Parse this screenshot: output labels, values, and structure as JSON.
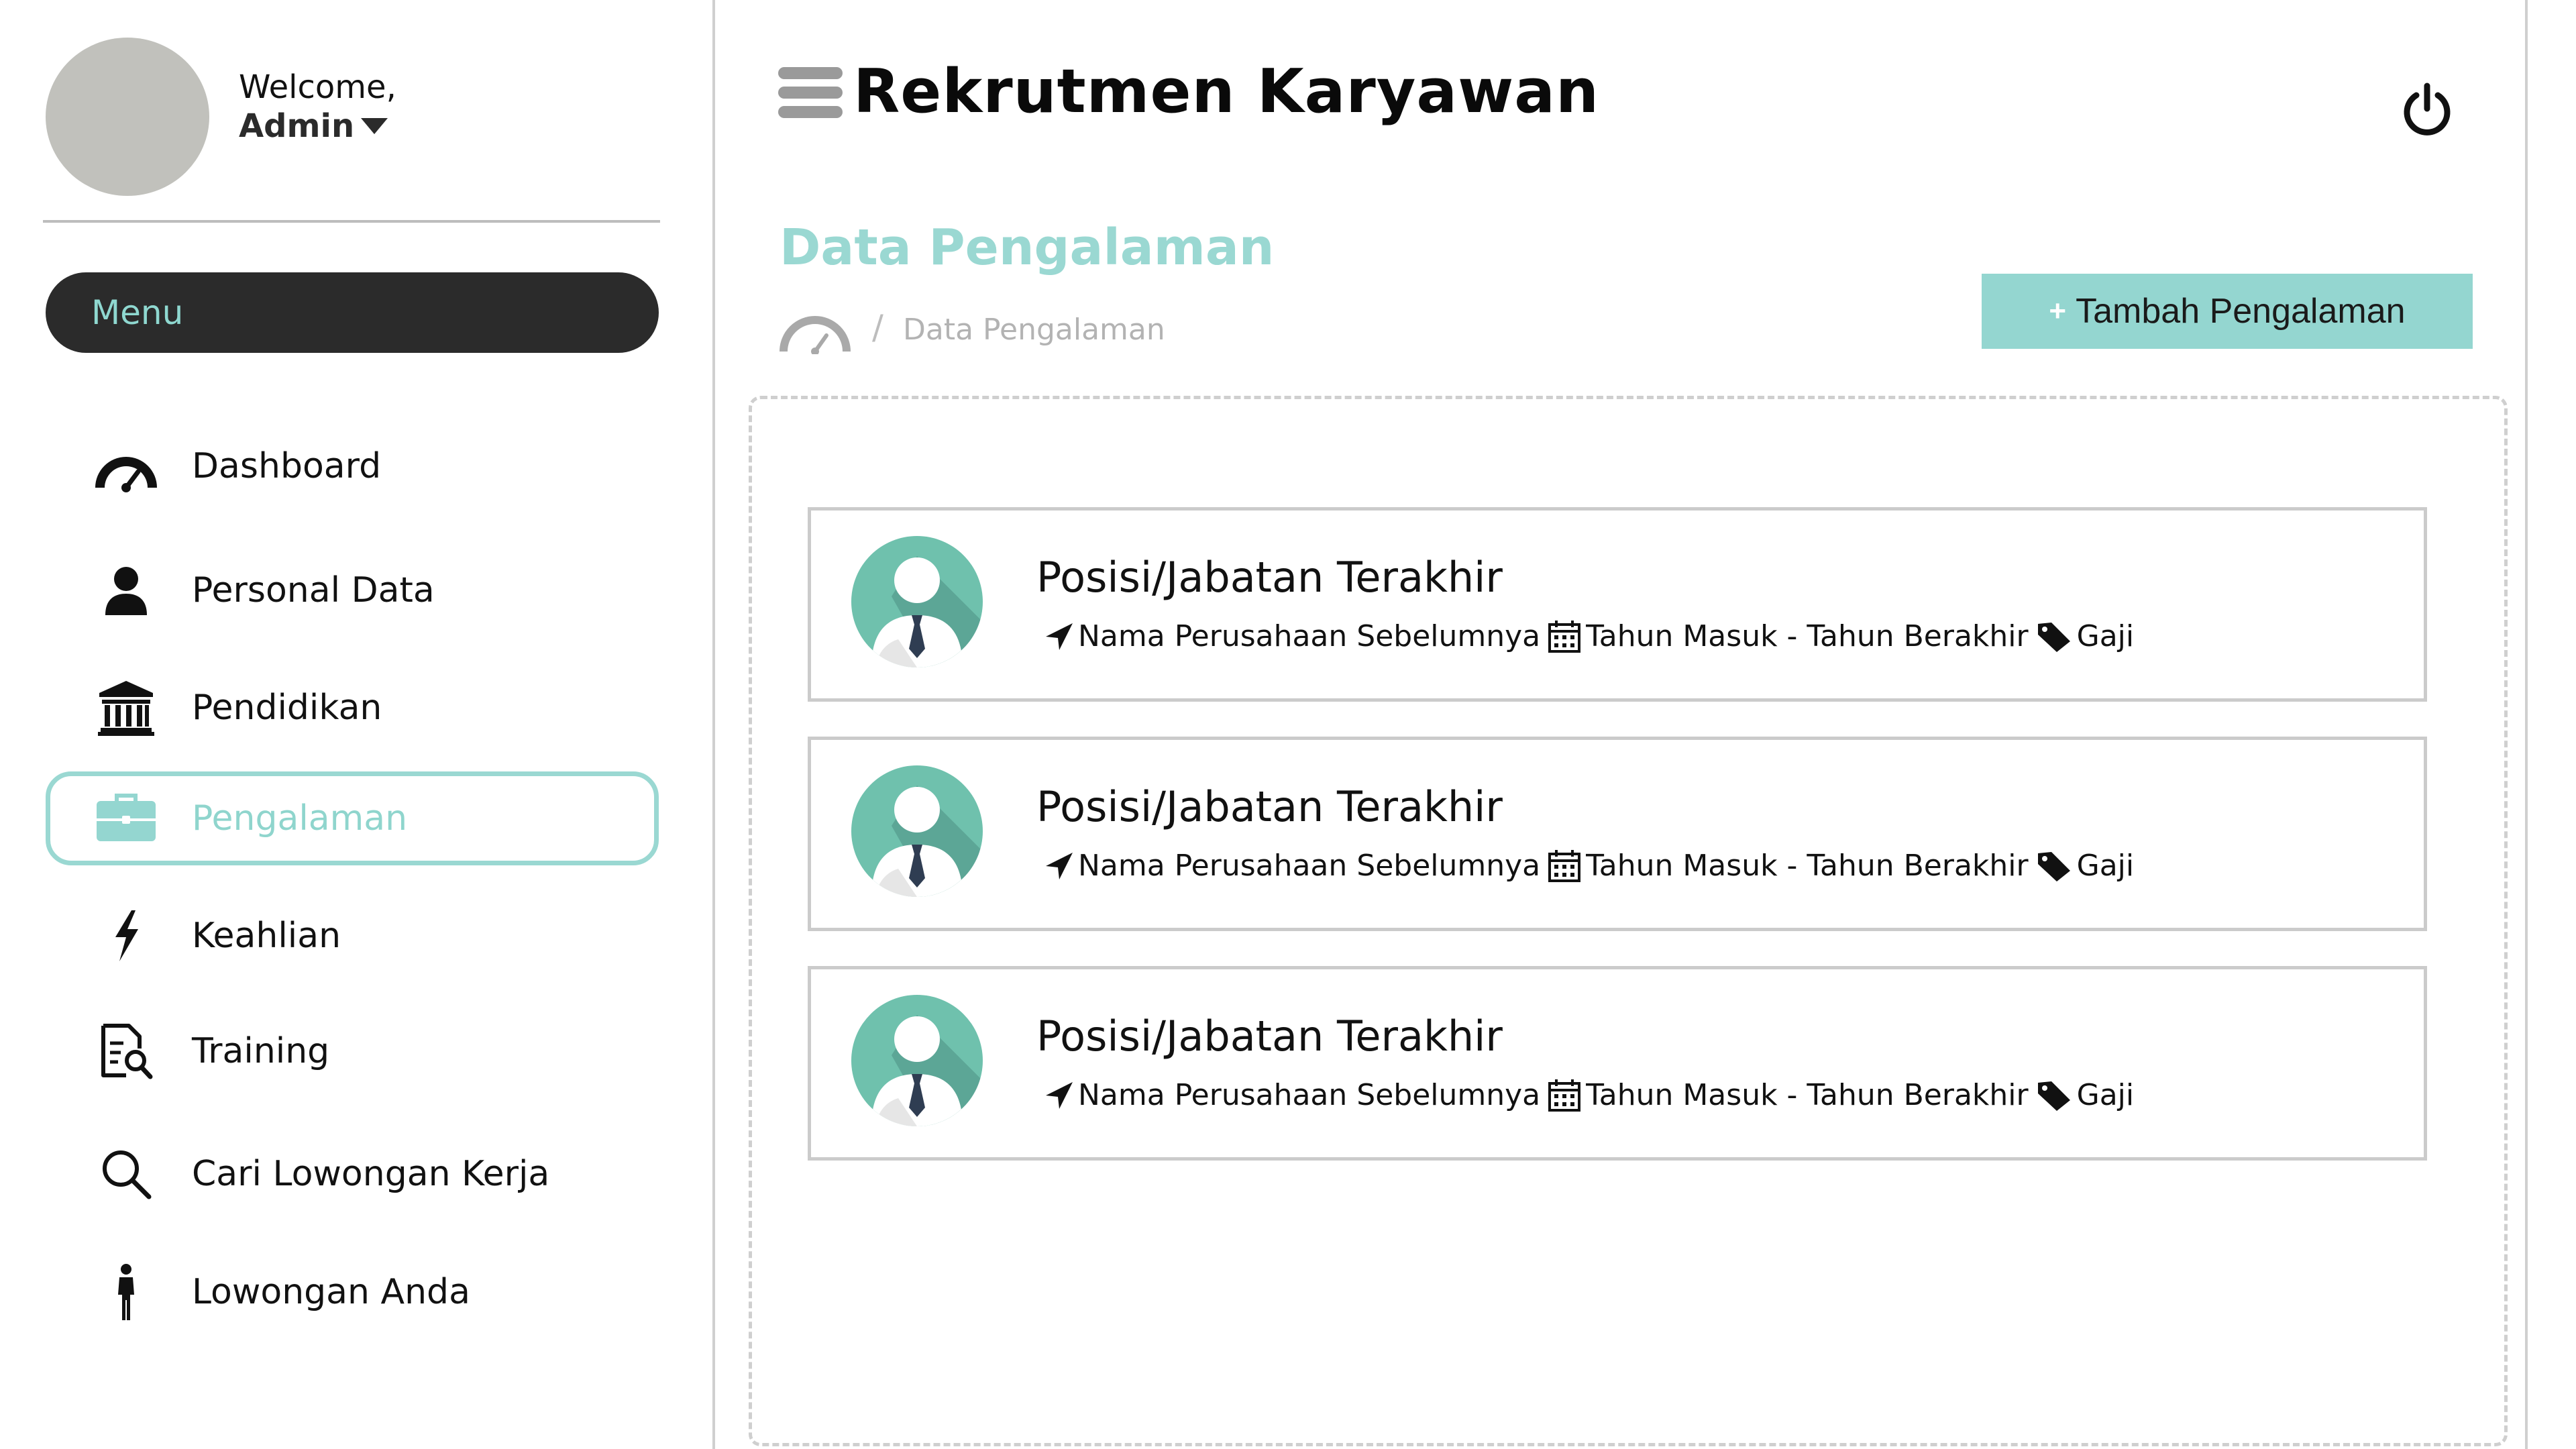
{
  "sidebar": {
    "welcome": "Welcome,",
    "user": "Admin",
    "menu_label": "Menu",
    "items": [
      {
        "label": "Dashboard",
        "icon": "dashboard-gauge-icon",
        "active": false
      },
      {
        "label": "Personal Data",
        "icon": "user-icon",
        "active": false
      },
      {
        "label": "Pendidikan",
        "icon": "institution-icon",
        "active": false
      },
      {
        "label": "Pengalaman",
        "icon": "briefcase-icon",
        "active": true
      },
      {
        "label": "Keahlian",
        "icon": "lightning-icon",
        "active": false
      },
      {
        "label": "Training",
        "icon": "document-search-icon",
        "active": false
      },
      {
        "label": "Cari Lowongan Kerja",
        "icon": "search-icon",
        "active": false
      },
      {
        "label": "Lowongan Anda",
        "icon": "person-standing-icon",
        "active": false
      }
    ]
  },
  "header": {
    "title": "Rekrutmen Karyawan",
    "menu_icon": "hamburger-icon",
    "power_icon": "power-icon"
  },
  "page": {
    "title": "Data Pengalaman",
    "breadcrumb_icon": "dashboard-gauge-icon",
    "breadcrumb_separator": "/",
    "breadcrumb": "Data Pengalaman",
    "add_button": {
      "plus": "+",
      "label": "Tambah Pengalaman"
    }
  },
  "experiences": [
    {
      "title": "Posisi/Jabatan Terakhir",
      "company": "Nama Perusahaan Sebelumnya",
      "period": "Tahun Masuk - Tahun Berakhir",
      "salary": "Gaji"
    },
    {
      "title": "Posisi/Jabatan Terakhir",
      "company": "Nama Perusahaan Sebelumnya",
      "period": "Tahun Masuk - Tahun Berakhir",
      "salary": "Gaji"
    },
    {
      "title": "Posisi/Jabatan Terakhir",
      "company": "Nama Perusahaan Sebelumnya",
      "period": "Tahun Masuk - Tahun Berakhir",
      "salary": "Gaji"
    }
  ],
  "colors": {
    "accent": "#94d6d0",
    "accent_text": "#8fd5cd",
    "menu_bg": "#2b2b2b",
    "avatar_placeholder": "#c1c1bc",
    "card_avatar": "#6fc1ad"
  }
}
